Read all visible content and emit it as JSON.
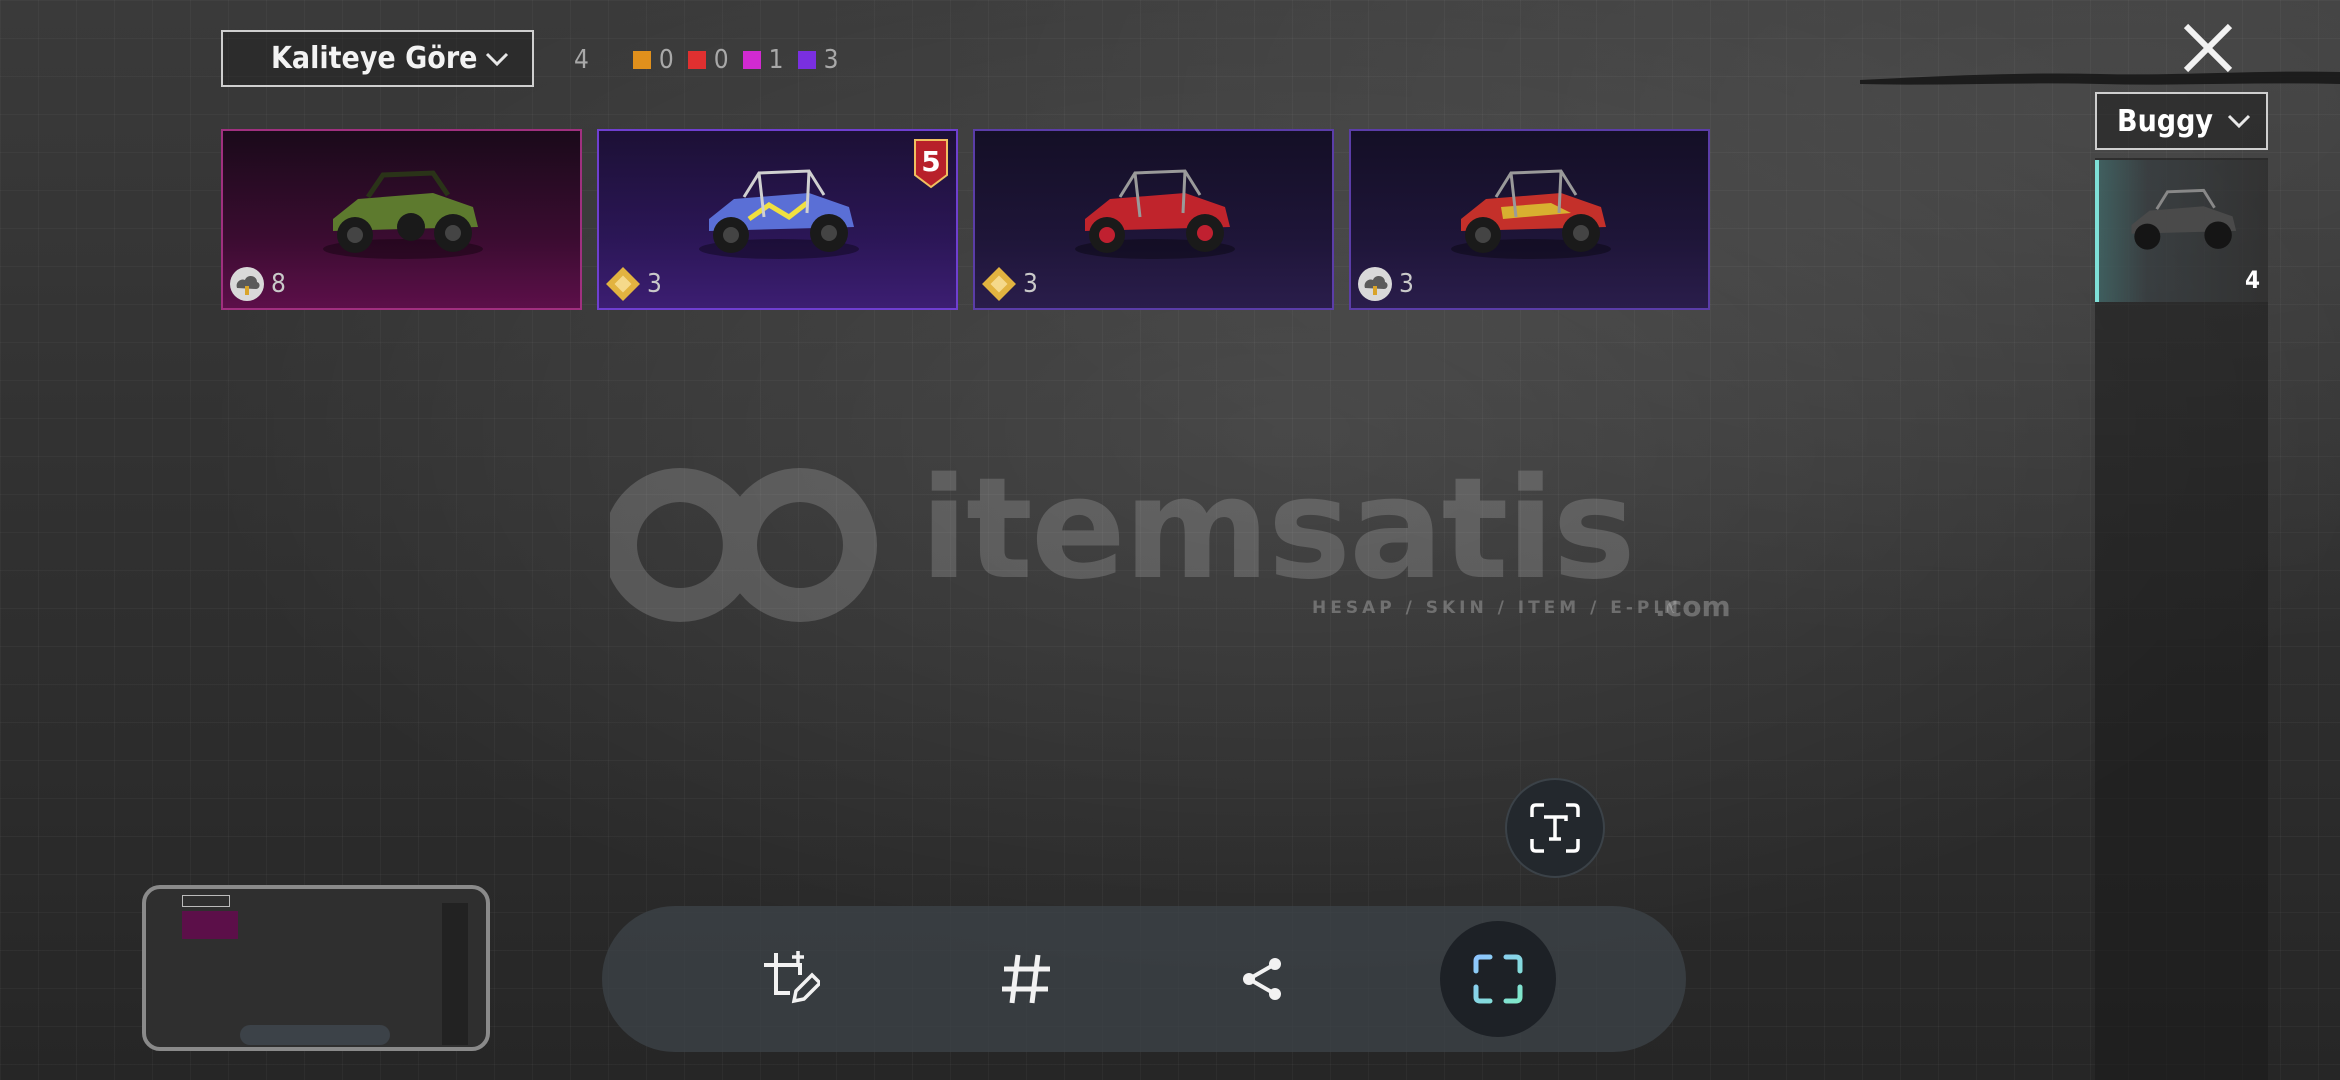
{
  "filter": {
    "sort_label": "Kaliteye Göre",
    "total_count": "4",
    "quality_counts": [
      {
        "color": "#e0901c",
        "count": "0"
      },
      {
        "color": "#e03030",
        "count": "0"
      },
      {
        "color": "#d12ad1",
        "count": "1"
      },
      {
        "color": "#7a2fe0",
        "count": "3"
      }
    ]
  },
  "vehicle_filter": {
    "label": "Buggy",
    "selected_item_count": "4"
  },
  "items": [
    {
      "quality": "pink",
      "currency_icon": "cloud-coin-icon",
      "amount": "8",
      "car_color": "#5d7a2e",
      "rank": ""
    },
    {
      "quality": "purple",
      "currency_icon": "diamond-coin-icon",
      "amount": "3",
      "car_color": "#5a6fd6",
      "rank": "5"
    },
    {
      "quality": "dark",
      "currency_icon": "diamond-coin-icon",
      "amount": "3",
      "car_color": "#c0242c",
      "rank": ""
    },
    {
      "quality": "dark",
      "currency_icon": "cloud-coin-icon",
      "amount": "3",
      "car_color": "#c4302a",
      "rank": ""
    }
  ],
  "watermark": {
    "brand": "itemsatis",
    "tagline": "HESAP / SKIN / ITEM / E-PIN",
    "domain": ".com"
  },
  "toolbar": {
    "buttons": [
      "crop-edit-icon",
      "hashtag-icon",
      "share-icon",
      "scan-icon"
    ]
  }
}
